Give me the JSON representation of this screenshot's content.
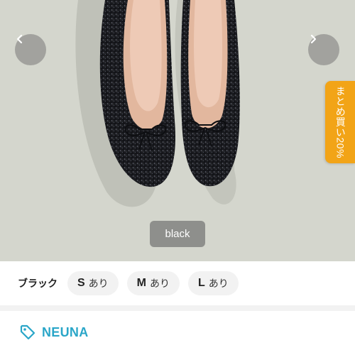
{
  "product_image": {
    "color_label": "black",
    "promo_tab": "まとめ買い20%",
    "colors": {
      "background": "#d4d6cd",
      "promo": "#f2a417"
    }
  },
  "nav": {
    "prev_icon": "chevron-left-icon",
    "next_icon": "chevron-right-icon"
  },
  "variant": {
    "color_name": "ブラック",
    "sizes": [
      {
        "size": "S",
        "availability": "あり"
      },
      {
        "size": "M",
        "availability": "あり"
      },
      {
        "size": "L",
        "availability": "あり"
      }
    ]
  },
  "brand": {
    "name": "NEUNA",
    "icon": "tag-icon",
    "color": "#2aa6c8"
  }
}
